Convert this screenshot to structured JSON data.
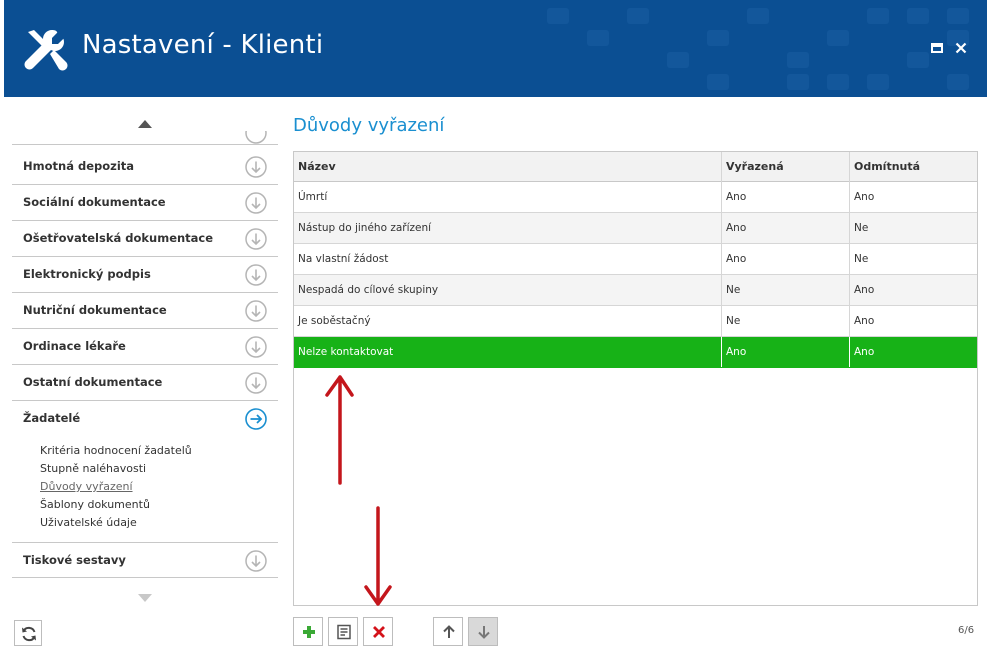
{
  "header": {
    "title": "Nastavení - Klienti",
    "icon": "wrench-screwdriver-icon",
    "maximize_icon": "maximize-icon",
    "close_icon": "close-icon",
    "background_color": "#0b4f93"
  },
  "sidebar": {
    "sections": [
      {
        "label": "Hmotná depozita",
        "icon": "arrow-down-circle-icon"
      },
      {
        "label": "Sociální dokumentace",
        "icon": "arrow-down-circle-icon"
      },
      {
        "label": "Ošetřovatelská dokumentace",
        "icon": "arrow-down-circle-icon"
      },
      {
        "label": "Elektronický podpis",
        "icon": "arrow-down-circle-icon"
      },
      {
        "label": "Nutriční dokumentace",
        "icon": "arrow-down-circle-icon"
      },
      {
        "label": "Ordinace lékaře",
        "icon": "arrow-down-circle-icon"
      },
      {
        "label": "Ostatní dokumentace",
        "icon": "arrow-down-circle-icon"
      },
      {
        "label": "Žadatelé",
        "icon": "arrow-right-circle-icon",
        "expanded": true
      },
      {
        "label": "Tiskové sestavy",
        "icon": "arrow-down-circle-icon"
      }
    ],
    "sub_items": [
      {
        "label": "Kritéria hodnocení žadatelů",
        "active": false
      },
      {
        "label": "Stupně naléhavosti",
        "active": false
      },
      {
        "label": "Důvody vyřazení",
        "active": true
      },
      {
        "label": "Šablony dokumentů",
        "active": false
      },
      {
        "label": "Uživatelské údaje",
        "active": false
      }
    ],
    "refresh_icon": "refresh-icon"
  },
  "main": {
    "title": "Důvody vyřazení",
    "accent_color": "#1a8fd0",
    "selected_row_color": "#17b217",
    "columns": [
      "Název",
      "Vyřazená",
      "Odmítnutá"
    ],
    "rows": [
      {
        "name": "Úmrtí",
        "vyrazena": "Ano",
        "odmitnuta": "Ano"
      },
      {
        "name": "Nástup do jiného zařízení",
        "vyrazena": "Ano",
        "odmitnuta": "Ne"
      },
      {
        "name": "Na vlastní žádost",
        "vyrazena": "Ano",
        "odmitnuta": "Ne"
      },
      {
        "name": "Nespadá do cílové skupiny",
        "vyrazena": "Ne",
        "odmitnuta": "Ano"
      },
      {
        "name": "Je soběstačný",
        "vyrazena": "Ne",
        "odmitnuta": "Ano"
      },
      {
        "name": "Nelze kontaktovat",
        "vyrazena": "Ano",
        "odmitnuta": "Ano",
        "selected": true
      }
    ],
    "toolbar": {
      "add_icon": "plus-icon",
      "edit_icon": "edit-document-icon",
      "delete_icon": "delete-x-icon",
      "move_up_icon": "arrow-up-icon",
      "move_down_icon": "arrow-down-icon"
    },
    "record_counter": "6/6"
  },
  "annotations": {
    "arrow_color": "#c4161c"
  }
}
